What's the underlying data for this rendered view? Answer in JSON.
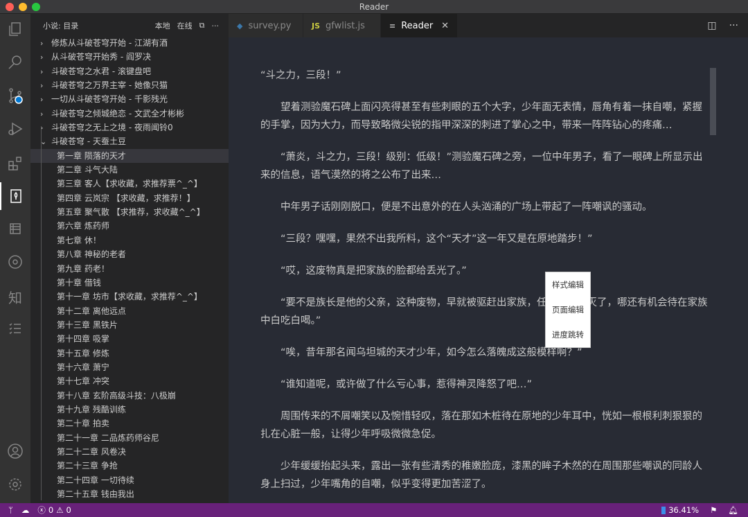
{
  "window": {
    "title": "Reader"
  },
  "sidebar": {
    "title": "小说: 目录",
    "actions": {
      "local": "本地",
      "online": "在线"
    },
    "books": [
      "修炼从斗破苍穹开始 - 江湖有酒",
      "从斗破苍穹开始秀 - 阎罗决",
      "斗破苍穹之水君 - 滚键盘吧",
      "斗破苍穹之万界主宰 - 她像只猫",
      "一切从斗破苍穹开始 - 千影残光",
      "斗破苍穹之倾城绝恋 - 文武全才彬彬",
      "斗破苍穹之无上之境 - 夜雨闻铃0",
      "斗破苍穹 - 天蚕土豆"
    ],
    "chapters": [
      "第一章 陨落的天才",
      "第二章 斗气大陆",
      "第三章 客人【求收藏，求推荐票^_^】",
      "第四章 云岚宗 【求收藏，求推荐！】",
      "第五章 聚气散 【求推荐，求收藏^_^】",
      "第六章 炼药师",
      "第七章 休！",
      "第八章 神秘的老者",
      "第九章 药老！",
      "第十章 借钱",
      "第十一章 坊市【求收藏，求推荐^_^】",
      "第十二章 离他远点",
      "第十三章 黑铁片",
      "第十四章 吸掌",
      "第十五章 修炼",
      "第十六章 萧宁",
      "第十七章 冲突",
      "第十八章 玄阶高级斗技：八极崩",
      "第十九章 残酷训练",
      "第二十章 拍卖",
      "第二十一章 二品炼药师谷尼",
      "第二十二章 风卷决",
      "第二十三章 争抢",
      "第二十四章 一切待续",
      "第二十五章 钱由我出"
    ]
  },
  "tabs": [
    {
      "label": "survey.py",
      "icon": "JS"
    },
    {
      "label": "gfwlist.js",
      "icon": "JS"
    },
    {
      "label": "Reader"
    }
  ],
  "reader": {
    "paragraphs": [
      "“斗之力，三段！”",
      "望着测验魔石碑上面闪亮得甚至有些刺眼的五个大字，少年面无表情，唇角有着一抹自嘲，紧握的手掌，因为大力，而导致略微尖锐的指甲深深的刺进了掌心之中，带来一阵阵钻心的疼痛…",
      "“萧炎，斗之力，三段！级别：低级！”测验魔石碑之旁，一位中年男子，看了一眼碑上所显示出来的信息，语气漠然的将之公布了出来…",
      "中年男子话刚刚脱口，便是不出意外的在人头汹涌的广场上带起了一阵嘲讽的骚动。",
      "“三段？嘿嘿，果然不出我所料，这个“天才”这一年又是在原地踏步！”",
      "“哎，这废物真是把家族的脸都给丢光了。”",
      "“要不是族长是他的父亲，这种废物，早就被驱赶出家族，任其自生自灭了，哪还有机会待在家族中白吃白喝。”",
      "“唉，昔年那名闻乌坦城的天才少年，如今怎么落魄成这般模样啊？”",
      "“谁知道呢，或许做了什么亏心事，惹得神灵降怒了吧…”",
      "周围传来的不屑嘲笑以及惋惜轻叹，落在那如木桩待在原地的少年耳中，恍如一根根利刺狠狠的扎在心脏一般，让得少年呼吸微微急促。",
      "少年缓缓抬起头来，露出一张有些清秀的稚嫩脸庞，漆黑的眸子木然的在周围那些嘲讽的同龄人身上扫过，少年嘴角的自嘲，似乎变得更加苦涩了。"
    ]
  },
  "context_menu": [
    "样式编辑",
    "页面编辑",
    "进度跳转"
  ],
  "status": {
    "errors": "0",
    "warnings": "0",
    "progress": "36.41%"
  },
  "colors": {
    "statusbar": "#68217a",
    "editor": "#282b34",
    "sidebar": "#252526"
  }
}
